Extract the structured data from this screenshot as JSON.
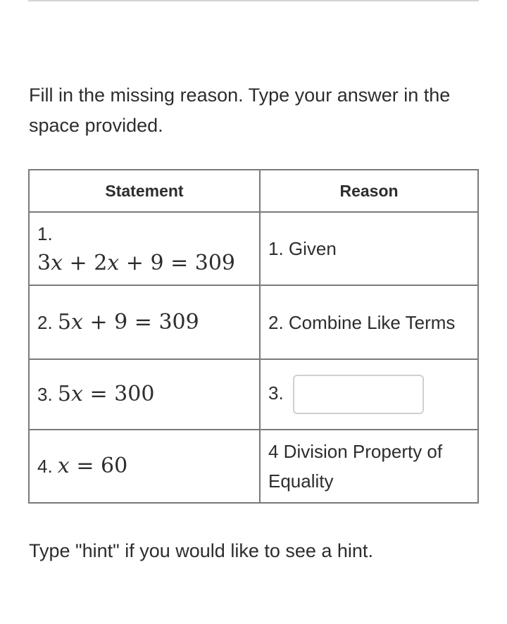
{
  "instructions": "Fill in the missing reason. Type your answer in the space provided.",
  "table": {
    "headers": {
      "statement": "Statement",
      "reason": "Reason"
    },
    "rows": [
      {
        "statement_num": "1.",
        "statement_math": "3x + 2x + 9 = 309",
        "reason": "1. Given"
      },
      {
        "statement_num": "2.",
        "statement_math": "5x + 9 = 309",
        "reason": "2. Combine Like Terms"
      },
      {
        "statement_num": "3.",
        "statement_math": "5x = 300",
        "reason_prefix": "3.",
        "reason_input_value": "",
        "reason_input_placeholder": ""
      },
      {
        "statement_num": "4.",
        "statement_math": "x = 60",
        "reason": "4 Division Property of Equality"
      }
    ]
  },
  "hint": "Type \"hint\" if you would like to see a hint."
}
